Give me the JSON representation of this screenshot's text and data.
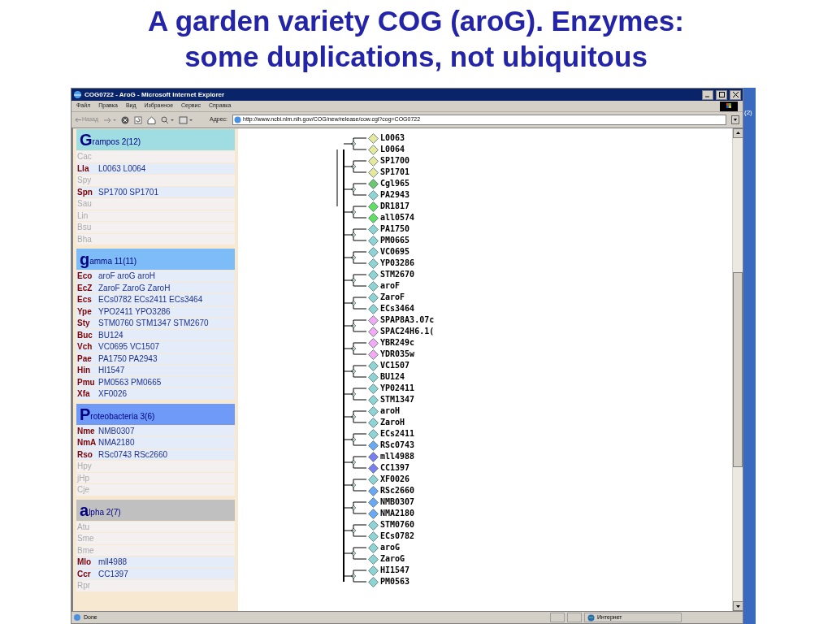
{
  "slide_title": [
    "A garden variety COG (aroG). Enzymes:",
    "some duplications, not ubiquitous"
  ],
  "side_note": "(2)",
  "window": {
    "title": "COG0722 - AroG - Microsoft Internet Explorer"
  },
  "menu": [
    "Файл",
    "Правка",
    "Вид",
    "Избранное",
    "Сервис",
    "Справка"
  ],
  "toolbar": {
    "back": "Назад",
    "address_label": "Адрес:",
    "address": "http://www.ncbi.nlm.nih.gov/COG/new/release/cow.cgi?cog=COG0722"
  },
  "groups": [
    {
      "initial": "G",
      "rest": "rampos 2(12)",
      "color": "#a0dde2",
      "rows": [
        {
          "code": "Cac"
        },
        {
          "code": "Lla",
          "genes": "L0063 L0064"
        },
        {
          "code": "Spy"
        },
        {
          "code": "Spn",
          "genes": "SP1700 SP1701"
        },
        {
          "code": "Sau"
        },
        {
          "code": "Lin"
        },
        {
          "code": "Bsu"
        },
        {
          "code": "Bha"
        }
      ]
    },
    {
      "initial": "g",
      "rest": "amma 11(11)",
      "color": "#7ebcf7",
      "rows": [
        {
          "code": "Eco",
          "genes": "aroF aroG aroH"
        },
        {
          "code": "EcZ",
          "genes": "ZaroF ZaroG ZaroH"
        },
        {
          "code": "Ecs",
          "genes": "ECs0782 ECs2411 ECs3464"
        },
        {
          "code": "Ype",
          "genes": "YPO2411 YPO3286"
        },
        {
          "code": "Sty",
          "genes": "STM0760 STM1347 STM2670"
        },
        {
          "code": "Buc",
          "genes": "BU124"
        },
        {
          "code": "Vch",
          "genes": "VC0695 VC1507"
        },
        {
          "code": "Pae",
          "genes": "PA1750 PA2943"
        },
        {
          "code": "Hin",
          "genes": "HI1547"
        },
        {
          "code": "Pmu",
          "genes": "PM0563 PM0665"
        },
        {
          "code": "Xfa",
          "genes": "XF0026"
        }
      ]
    },
    {
      "initial": "P",
      "rest": "roteobacteria 3(6)",
      "color": "#6f9af7",
      "rows": [
        {
          "code": "Nme",
          "genes": "NMB0307"
        },
        {
          "code": "NmA",
          "genes": "NMA2180"
        },
        {
          "code": "Rso",
          "genes": "RSc0743 RSc2660"
        },
        {
          "code": "Hpy"
        },
        {
          "code": "jHp"
        },
        {
          "code": "Cje"
        }
      ]
    },
    {
      "initial": "a",
      "rest": "lpha 2(7)",
      "color": "#c0c0c0",
      "rows": [
        {
          "code": "Atu"
        },
        {
          "code": "Sme"
        },
        {
          "code": "Bme"
        },
        {
          "code": "Mlo",
          "genes": "mll4988"
        },
        {
          "code": "Ccr",
          "genes": "CC1397"
        },
        {
          "code": "Rpr"
        }
      ]
    }
  ],
  "leaves": [
    {
      "label": "L0063",
      "color": "#e8e89c"
    },
    {
      "label": "L0064",
      "color": "#e8e89c"
    },
    {
      "label": "SP1700",
      "color": "#e8e89c"
    },
    {
      "label": "SP1701",
      "color": "#e8e89c"
    },
    {
      "label": "Cgl965",
      "color": "#6cc86c"
    },
    {
      "label": "PA2943",
      "color": "#8fd4d4"
    },
    {
      "label": "DR1817",
      "color": "#5ee05e"
    },
    {
      "label": "all0574",
      "color": "#5ee05e"
    },
    {
      "label": "PA1750",
      "color": "#8fd4d4"
    },
    {
      "label": "PM0665",
      "color": "#8fd4d4"
    },
    {
      "label": "VC0695",
      "color": "#8fd4d4"
    },
    {
      "label": "YP03286",
      "color": "#8fd4d4"
    },
    {
      "label": "STM2670",
      "color": "#8fd4d4"
    },
    {
      "label": "aroF",
      "color": "#8fd4d4"
    },
    {
      "label": "ZaroF",
      "color": "#8fd4d4"
    },
    {
      "label": "ECs3464",
      "color": "#8fd4d4"
    },
    {
      "label": "SPAP8A3.07c",
      "color": "#f5a8f5"
    },
    {
      "label": "SPAC24H6.1(",
      "color": "#f5a8f5"
    },
    {
      "label": "YBR249c",
      "color": "#f5a8f5"
    },
    {
      "label": "YDR035w",
      "color": "#f5a8f5"
    },
    {
      "label": "VC1507",
      "color": "#8fd4d4"
    },
    {
      "label": "BU124",
      "color": "#8fd4d4"
    },
    {
      "label": "YP02411",
      "color": "#8fd4d4"
    },
    {
      "label": "STM1347",
      "color": "#8fd4d4"
    },
    {
      "label": "aroH",
      "color": "#8fd4d4"
    },
    {
      "label": "ZaroH",
      "color": "#8fd4d4"
    },
    {
      "label": "ECs2411",
      "color": "#8fd4d4"
    },
    {
      "label": "RSc0743",
      "color": "#6aa8f5"
    },
    {
      "label": "mll4988",
      "color": "#7a7ef0"
    },
    {
      "label": "CC1397",
      "color": "#7a7ef0"
    },
    {
      "label": "XF0026",
      "color": "#8fd4d4"
    },
    {
      "label": "RSc2660",
      "color": "#6aa8f5"
    },
    {
      "label": "NMB0307",
      "color": "#6aa8f5"
    },
    {
      "label": "NMA2180",
      "color": "#6aa8f5"
    },
    {
      "label": "STM0760",
      "color": "#8fd4d4"
    },
    {
      "label": "ECs0782",
      "color": "#8fd4d4"
    },
    {
      "label": "aroG",
      "color": "#8fd4d4"
    },
    {
      "label": "ZaroG",
      "color": "#8fd4d4"
    },
    {
      "label": "HI1547",
      "color": "#8fd4d4"
    },
    {
      "label": "PM0563",
      "color": "#8fd4d4"
    }
  ],
  "status_bar": {
    "left": "Done",
    "zone": "Интернет"
  }
}
